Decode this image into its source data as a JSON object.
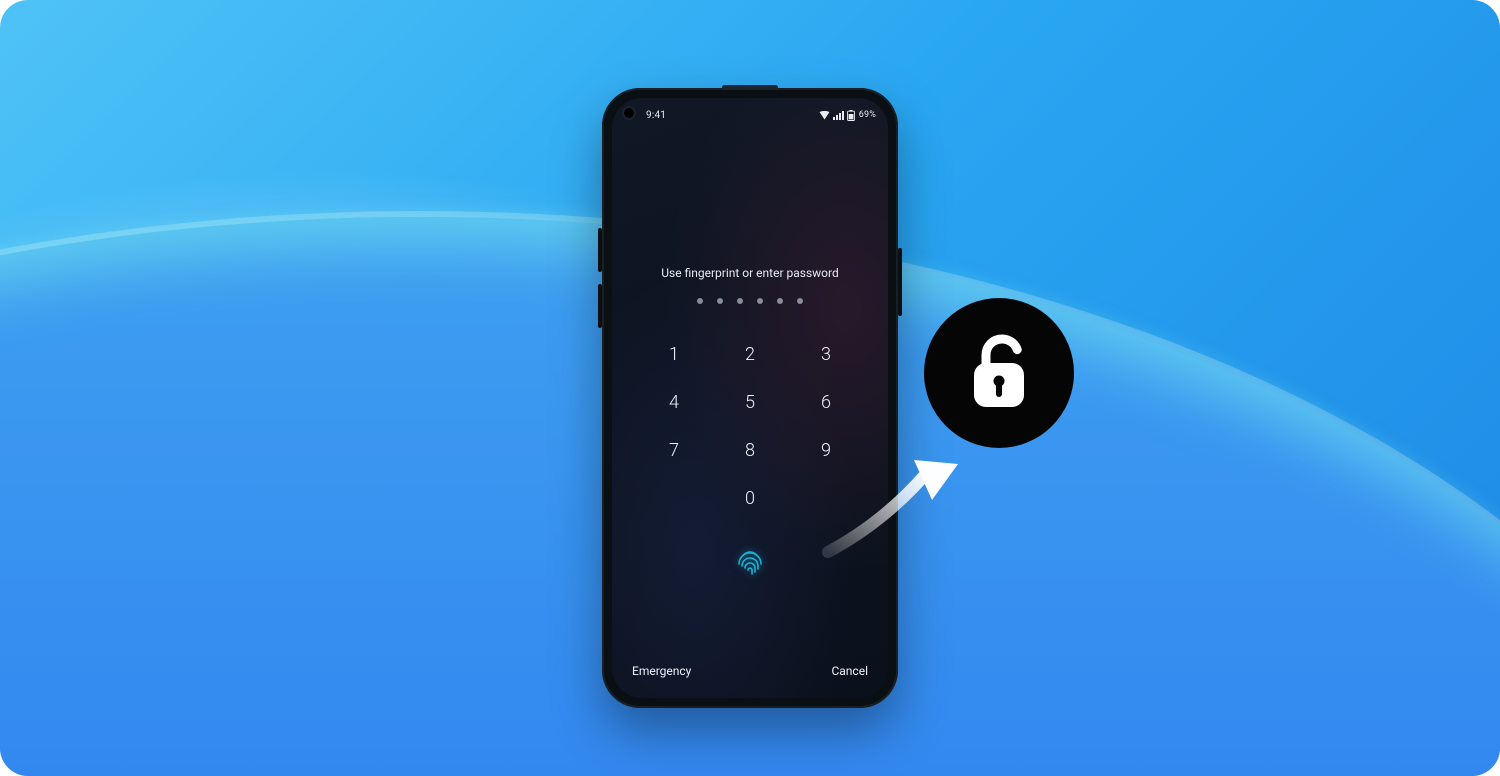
{
  "status": {
    "time": "9:41",
    "battery_text": "69%"
  },
  "lock": {
    "prompt": "Use fingerprint or enter password",
    "pin_length": 6
  },
  "keypad": {
    "k1": "1",
    "k2": "2",
    "k3": "3",
    "k4": "4",
    "k5": "5",
    "k6": "6",
    "k7": "7",
    "k8": "8",
    "k9": "9",
    "k0": "0"
  },
  "actions": {
    "emergency": "Emergency",
    "cancel": "Cancel"
  },
  "icons": {
    "wifi": "wifi-icon",
    "signal": "signal-icon",
    "battery": "battery-icon",
    "fingerprint": "fingerprint-icon",
    "unlock": "unlock-icon",
    "arrow": "arrow-icon"
  }
}
